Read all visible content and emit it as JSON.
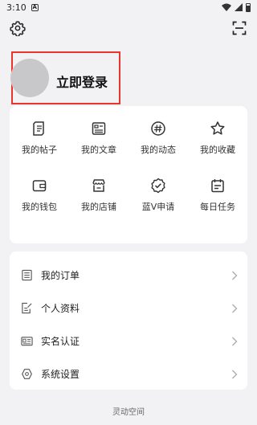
{
  "status_bar": {
    "time": "3:10",
    "notification_letter": "A"
  },
  "profile": {
    "login_label": "立即登录"
  },
  "grid": {
    "items": [
      {
        "label": "我的帖子",
        "icon": "post-icon"
      },
      {
        "label": "我的文章",
        "icon": "article-icon"
      },
      {
        "label": "我的动态",
        "icon": "hashtag-icon"
      },
      {
        "label": "我的收藏",
        "icon": "star-icon"
      },
      {
        "label": "我的钱包",
        "icon": "wallet-icon"
      },
      {
        "label": "我的店铺",
        "icon": "store-icon"
      },
      {
        "label": "蓝V申请",
        "icon": "verified-badge-icon"
      },
      {
        "label": "每日任务",
        "icon": "calendar-icon"
      }
    ]
  },
  "menu": {
    "items": [
      {
        "label": "我的订单",
        "icon": "order-icon"
      },
      {
        "label": "个人资料",
        "icon": "profile-edit-icon"
      },
      {
        "label": "实名认证",
        "icon": "id-card-icon"
      },
      {
        "label": "系统设置",
        "icon": "settings-hex-icon"
      }
    ]
  },
  "footer": {
    "text": "灵动空间"
  }
}
